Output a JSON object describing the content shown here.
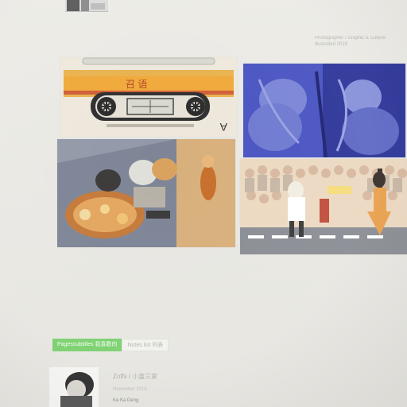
{
  "top_thumbnail": {
    "name": "previous-post-thumbnail"
  },
  "sidebar_meta": {
    "line1": "Photographer / Graphic & Culture",
    "line2": "Illustrated 2018"
  },
  "gallery": {
    "images": [
      {
        "name": "cassette-tape-illustration",
        "caption": "召語"
      },
      {
        "name": "blue-couple-illustration",
        "caption": ""
      },
      {
        "name": "group-above-table-illustration",
        "caption": ""
      },
      {
        "name": "crowd-dance-illustration",
        "caption": ""
      }
    ]
  },
  "tabs": [
    {
      "label": "Pagessubtitles 我喜歡的",
      "active": true
    },
    {
      "label": "Notes list 列表",
      "active": false
    }
  ],
  "author_card": {
    "title": "Zoffs / 小盒三家",
    "date": "November 2018",
    "name": "Ke Ka Deng"
  },
  "colors": {
    "tab_active": "#7bd06f",
    "page_bg": "#ecebe6"
  }
}
